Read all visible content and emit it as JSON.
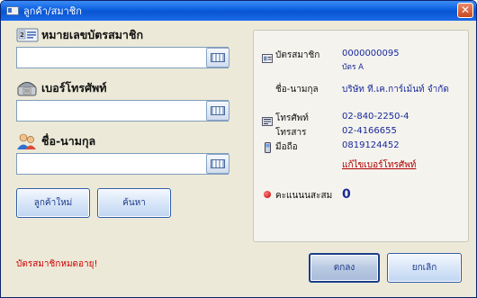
{
  "window": {
    "title": "ลูกค้า/สมาชิก",
    "close_glyph": "✕"
  },
  "fields": {
    "member_card": {
      "label": "หมายเลขบัตรสมาชิก",
      "value": "",
      "icon": "member-card-icon"
    },
    "phone": {
      "label": "เบอร์โทรศัพท์",
      "value": "",
      "icon": "telephone-icon"
    },
    "name": {
      "label": "ชื่อ-นามกุล",
      "value": "",
      "icon": "people-icon"
    }
  },
  "buttons": {
    "new_customer": "ลูกค้าใหม่",
    "search": "ค้นหา",
    "ok": "ตกลง",
    "cancel": "ยกเลิก"
  },
  "info": {
    "member_card_label": "บัตรสมาชิก",
    "member_card_value": "0000000095",
    "card_type": "บัตร A",
    "name_label": "ชื่อ-นามกุล",
    "name_value": "บริษัท ที.เค.การ์เม้นท์ จำกัด",
    "phone_label": "โทรศัพท์",
    "phone_value": "02-840-2250-4",
    "fax_label": "โทรสาร",
    "fax_value": "02-4166655",
    "mobile_label": "มือถือ",
    "mobile_value": "0819124452",
    "edit_phone_link": "แก้ไขเบอร์โทรศัพท์",
    "points_label": "คะแนนนสะสม",
    "points_value": "0"
  },
  "status_message": "บัตรสมาชิกหมดอายุ!",
  "colors": {
    "link": "#b00000",
    "value": "#1a2a9a",
    "status": "#d00000",
    "titlebar": "#0b5fe0"
  }
}
